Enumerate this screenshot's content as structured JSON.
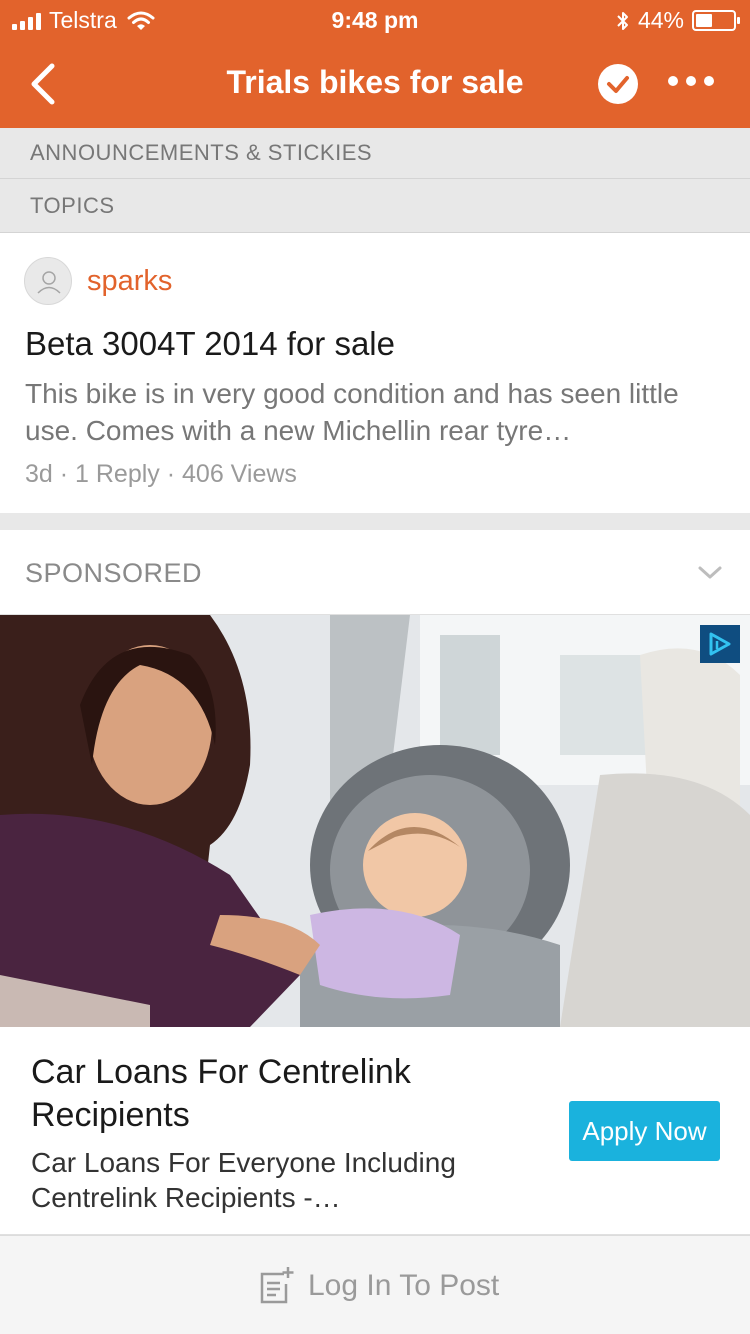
{
  "status_bar": {
    "carrier": "Telstra",
    "time": "9:48 pm",
    "battery_text": "44%",
    "battery_level": 0.44
  },
  "nav": {
    "title": "Trials bikes for sale"
  },
  "sections": {
    "announcements": "ANNOUNCEMENTS & STICKIES",
    "topics": "TOPICS"
  },
  "topic": {
    "author": "sparks",
    "title": "Beta 3004T 2014 for sale",
    "excerpt": "This bike is in very good condition and has seen little use. Comes with a new Michellin rear tyre…",
    "meta": "3d · 1 Reply · 406 Views"
  },
  "sponsored": {
    "label": "SPONSORED",
    "ad_title": "Car Loans For Centrelink Recipients",
    "ad_description": "Car Loans For Everyone Including Centrelink Recipients -…",
    "cta": "Apply Now"
  },
  "bottom": {
    "login_label": "Log In To Post"
  },
  "colors": {
    "brand": "#e2632c",
    "cta": "#1ab2dd",
    "section_bg": "#e8e8e8"
  },
  "icons": [
    "signal-icon",
    "wifi-icon",
    "bluetooth-icon",
    "battery-icon",
    "back-arrow-icon",
    "check-circle-icon",
    "more-icon",
    "avatar-placeholder-icon",
    "chevron-down-icon",
    "ad-choices-icon",
    "compose-icon"
  ]
}
